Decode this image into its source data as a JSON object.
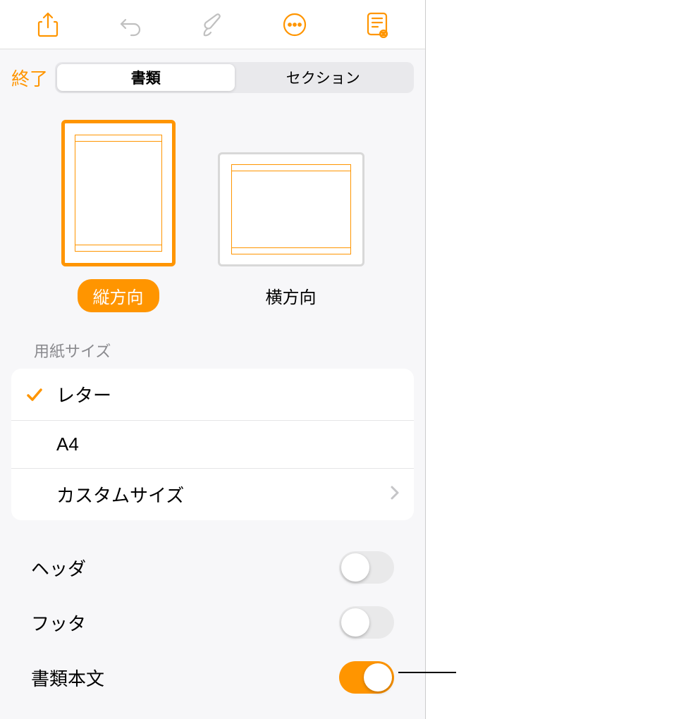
{
  "header": {
    "done": "終了",
    "tabs": [
      "書類",
      "セクション"
    ],
    "active_tab": 0
  },
  "orientation": {
    "portrait": "縦方向",
    "landscape": "横方向",
    "selected": "portrait"
  },
  "paper_size": {
    "header": "用紙サイズ",
    "options": [
      "レター",
      "A4",
      "カスタムサイズ"
    ],
    "selected": 0
  },
  "toggles": {
    "header": {
      "label": "ヘッダ",
      "on": false
    },
    "footer": {
      "label": "フッタ",
      "on": false
    },
    "body": {
      "label": "書類本文",
      "on": true
    }
  },
  "icons": {
    "share": "share-icon",
    "undo": "undo-icon",
    "format": "brush-icon",
    "more": "more-icon",
    "reader": "reader-icon"
  },
  "colors": {
    "accent": "#ff9500",
    "disabled": "#c0c0c0"
  }
}
